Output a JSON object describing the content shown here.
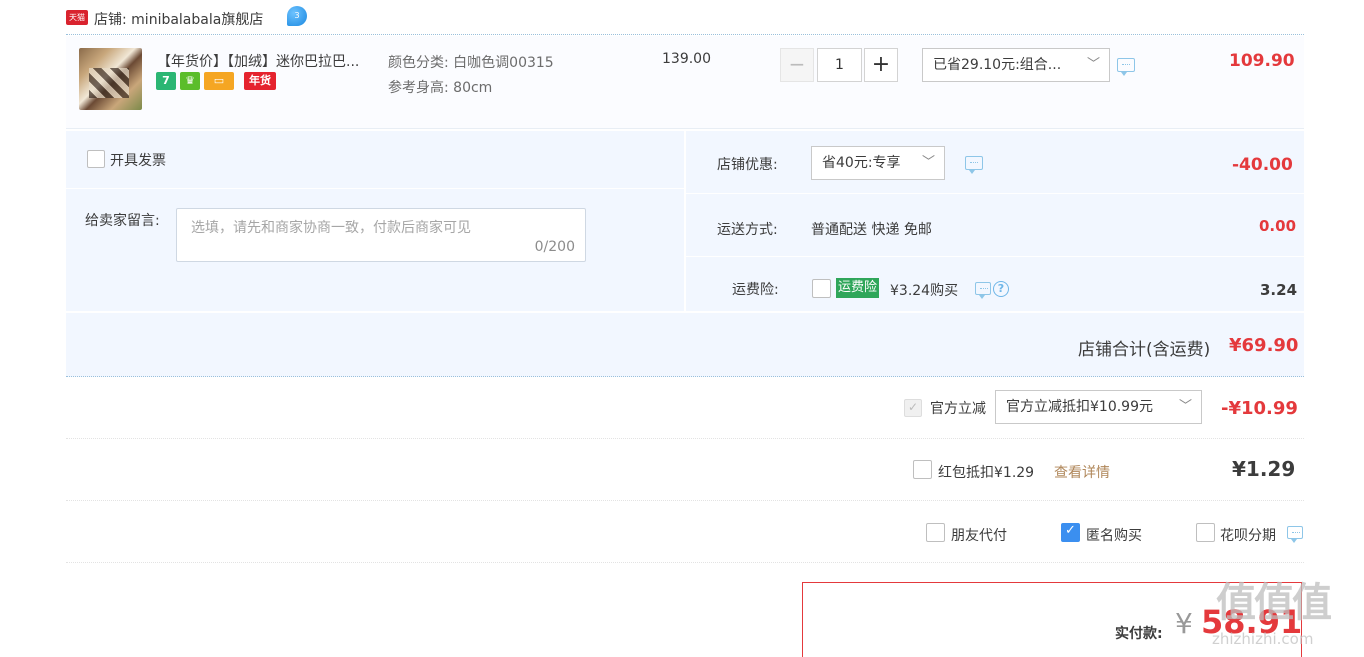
{
  "shop": {
    "badge": "天猫",
    "label": "店铺: minibalabala旗舰店",
    "ww_badge": "3"
  },
  "item": {
    "title": "【年货价】【加绒】迷你巴拉巴...",
    "badges": [
      "7",
      "",
      "",
      "年货"
    ],
    "sku_color": "颜色分类: 白咖色调00315",
    "sku_height": "参考身高: 80cm",
    "unit_price": "139.00",
    "qty_minus": "−",
    "quantity": "1",
    "qty_plus": "+",
    "promo_select": "已省29.10元:组合...",
    "total": "109.90"
  },
  "invoice": {
    "label": "开具发票"
  },
  "message": {
    "label": "给卖家留言:",
    "placeholder": "选填，请先和商家协商一致，付款后商家可见",
    "counter": "0/200"
  },
  "shop_discount": {
    "label": "店铺优惠:",
    "select": "省40元:专享",
    "amount": "-40.00"
  },
  "shipping": {
    "label": "运送方式:",
    "value": "普通配送 快递 免邮",
    "amount": "0.00"
  },
  "freight_insurance": {
    "label": "运费险:",
    "tag": "运费险",
    "price": "¥3.24购买",
    "help": "?",
    "amount": "3.24"
  },
  "shop_total": {
    "label": "店铺合计(含运费)",
    "amount": "¥69.90"
  },
  "official_discount": {
    "label": "官方立减",
    "select": "官方立减抵扣¥10.99元",
    "amount": "-¥10.99"
  },
  "red_packet": {
    "label": "红包抵扣¥1.29",
    "link": "查看详情",
    "amount": "¥1.29"
  },
  "options": {
    "friend_pay": "朋友代付",
    "anonymous": "匿名购买",
    "huabei": "花呗分期"
  },
  "pay": {
    "label": "实付款:",
    "currency": "¥",
    "amount": "58.91"
  },
  "watermark": {
    "logo": "值值值",
    "url": "zhizhizhi.com"
  },
  "icons": {
    "chevron": "chevron-down-icon",
    "message": "chat-bubble-icon",
    "help": "question-circle-icon"
  },
  "colors": {
    "price_red": "#e4393c",
    "panel_bg": "#f2f7ff",
    "checkbox_blue": "#3b8ff0",
    "insurance_green": "#2fa65a"
  }
}
